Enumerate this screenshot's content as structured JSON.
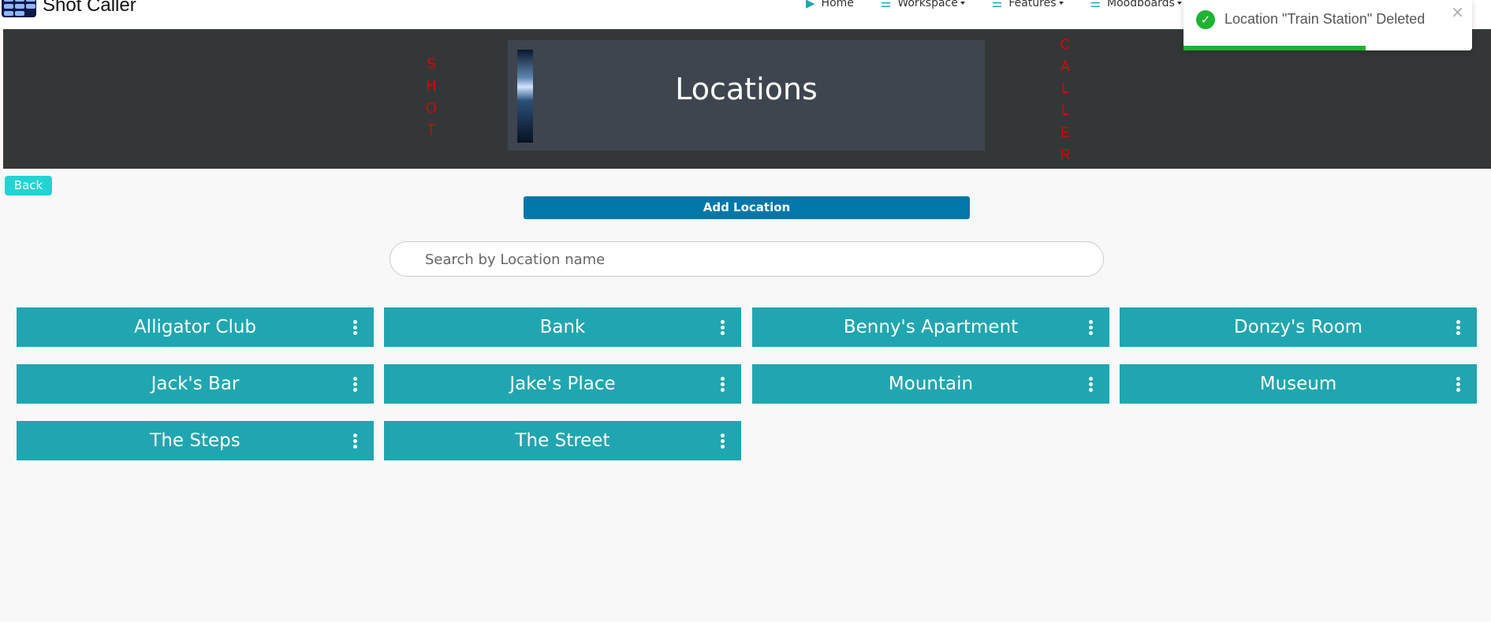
{
  "navbar": {
    "brand": "Shot Caller",
    "links": [
      {
        "label": "Home",
        "icon": "play-icon",
        "dropdown": false
      },
      {
        "label": "Workspace",
        "icon": "menu-icon",
        "dropdown": true
      },
      {
        "label": "Features",
        "icon": "menu-icon",
        "dropdown": true
      },
      {
        "label": "Moodboards",
        "icon": "menu-icon",
        "dropdown": true
      }
    ]
  },
  "toast": {
    "message": "Location \"Train Station\" Deleted",
    "close_glyph": "×",
    "check_glyph": "✓",
    "progress": 0.63,
    "color": "#1fb333"
  },
  "banner": {
    "left_word": [
      "S",
      "H",
      "O",
      "T"
    ],
    "right_word": [
      "C",
      "A",
      "L",
      "L",
      "E",
      "R"
    ],
    "title": "Locations"
  },
  "actions": {
    "back_label": "Back",
    "add_label": "Add Location"
  },
  "search": {
    "placeholder": "Search by Location name"
  },
  "locations": [
    "Alligator Club",
    "Bank",
    "Benny's Apartment",
    "Donzy's Room",
    "Jack's Bar",
    "Jake's Place",
    "Mountain",
    "Museum",
    "The Steps",
    "The Street"
  ],
  "colors": {
    "accent": "#20a6b0",
    "primary_button": "#0077a8",
    "back_button": "#23d3d3",
    "banner_bg": "#343738",
    "banner_letters": "#e00000"
  }
}
